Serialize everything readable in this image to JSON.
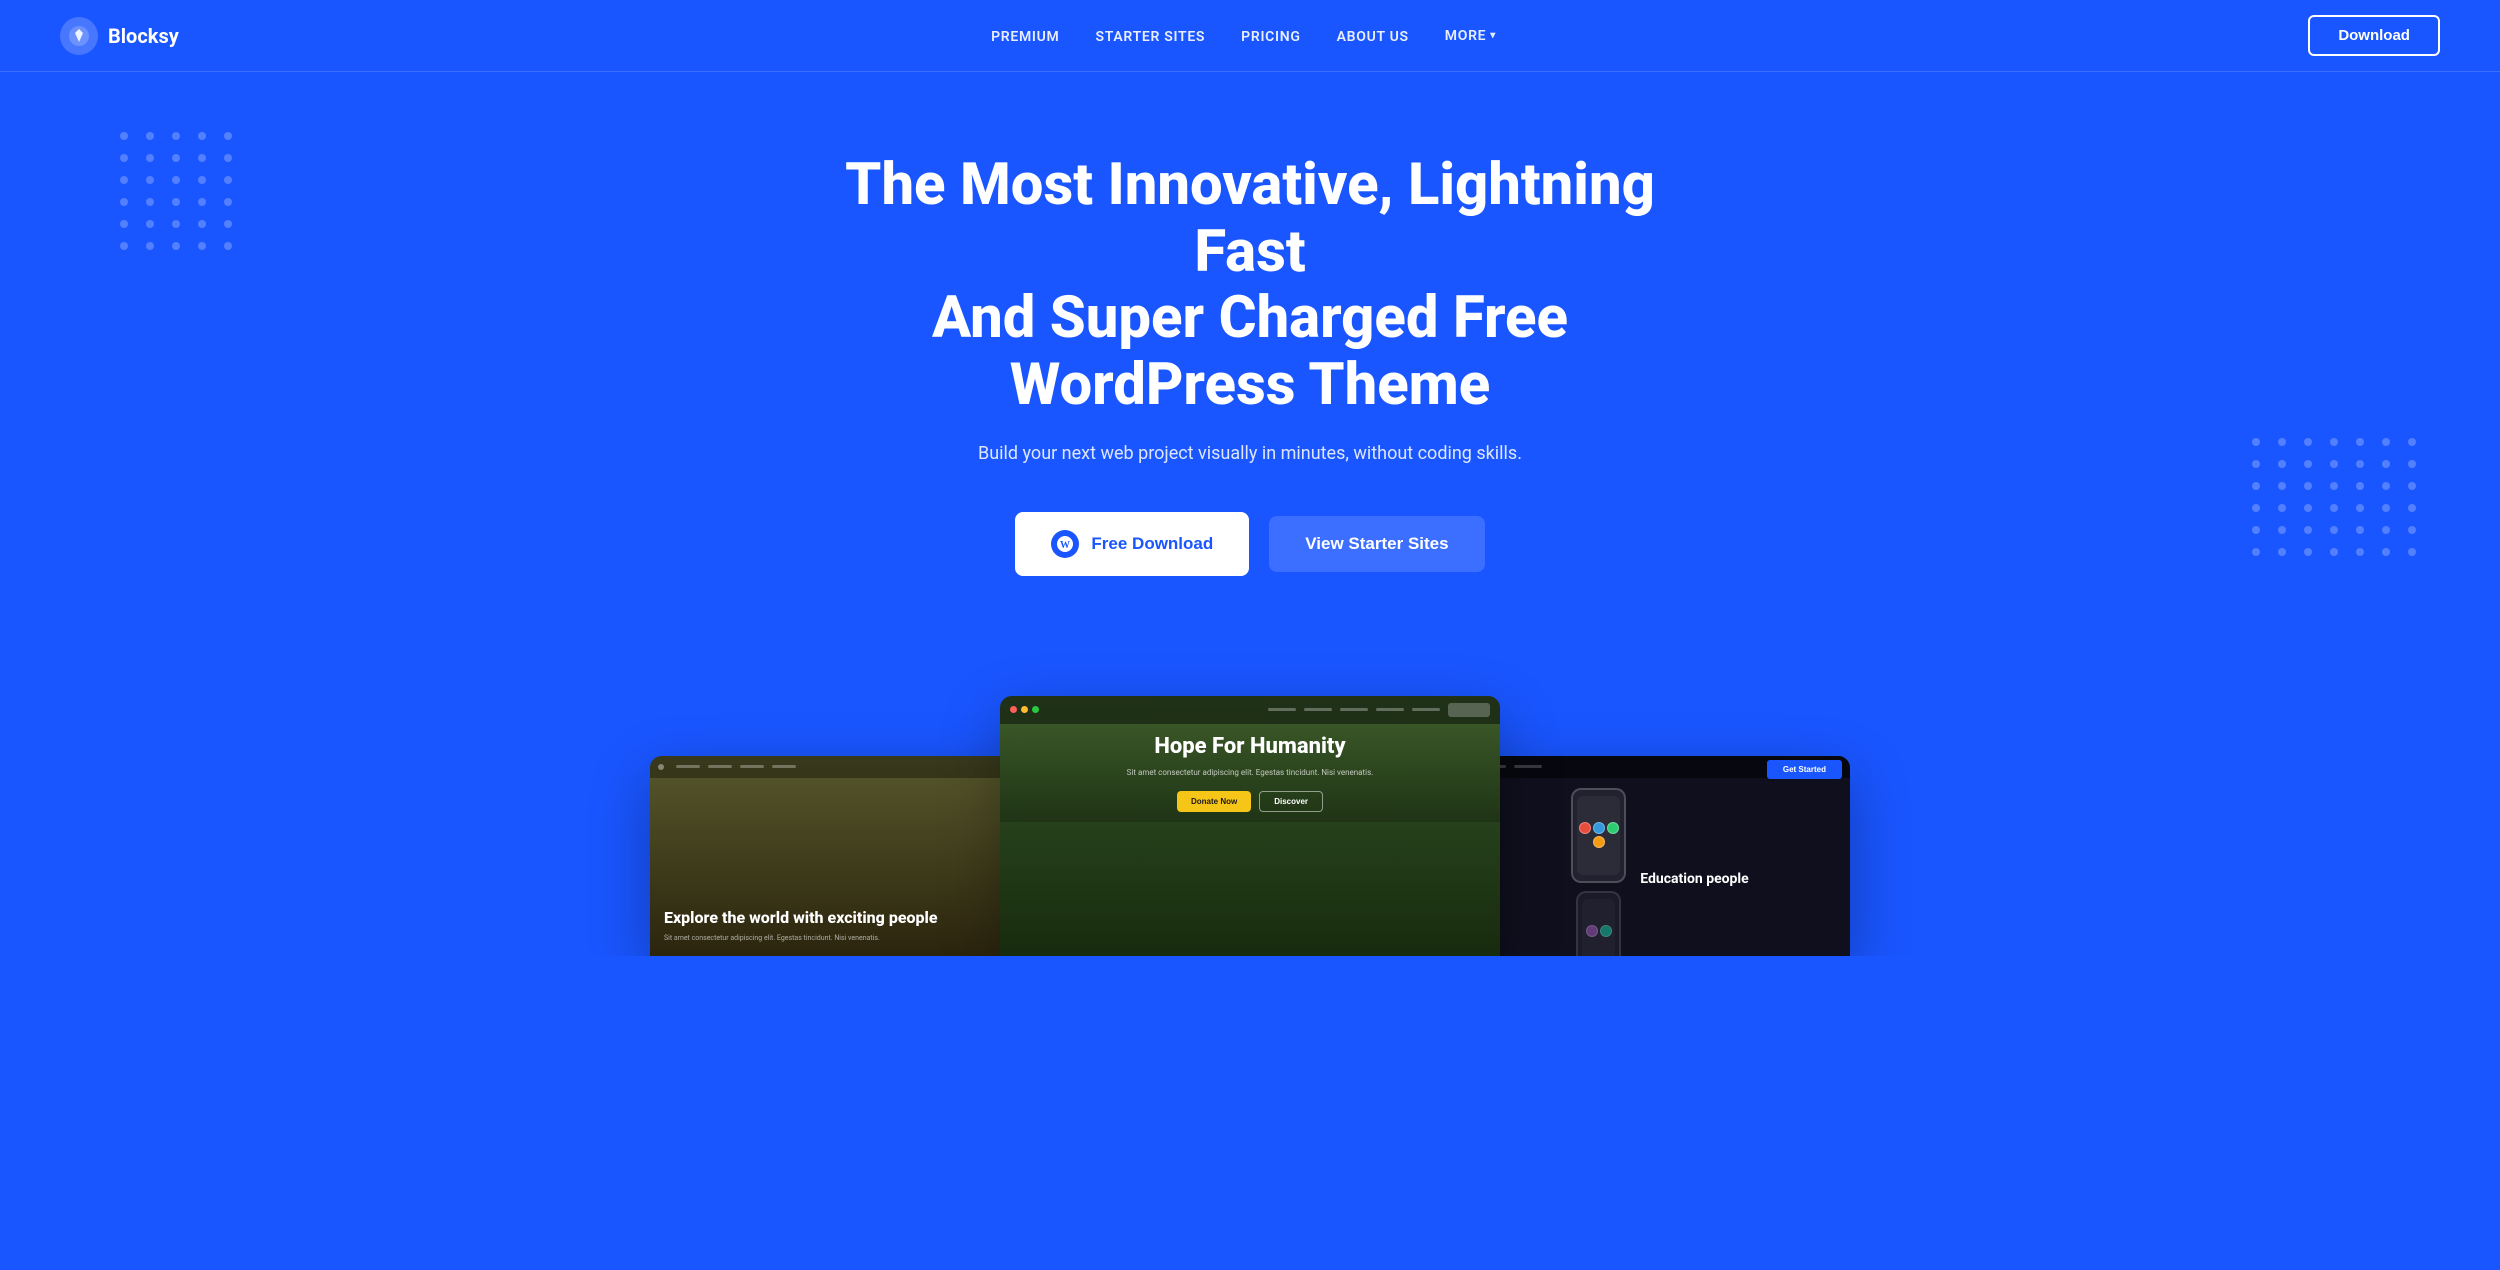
{
  "brand": {
    "logo_symbol": "⚡",
    "name": "Blocksy"
  },
  "nav": {
    "links": [
      {
        "id": "premium",
        "label": "PREMIUM"
      },
      {
        "id": "starter-sites",
        "label": "STARTER SITES"
      },
      {
        "id": "pricing",
        "label": "PRICING"
      },
      {
        "id": "about-us",
        "label": "ABOUT US"
      },
      {
        "id": "more",
        "label": "MORE"
      }
    ],
    "download_button": "Download"
  },
  "hero": {
    "title_line1": "The Most Innovative, Lightning Fast",
    "title_line2": "And Super Charged Free WordPress Theme",
    "subtitle": "Build your next web project visually in minutes, without coding skills.",
    "btn_free_download": "Free Download",
    "btn_starter_sites": "View Starter Sites",
    "wordpress_icon": "W"
  },
  "preview": {
    "cards": [
      {
        "id": "left",
        "title": "Explore the world with exciting people",
        "subtext": "Sit amet consectetur adipiscing elit. Egestas tincidunt. Nisi venenatis."
      },
      {
        "id": "main",
        "title": "Hope For Humanity",
        "subtext": "Sit amet consectetur adipiscing elit. Egestas tincidunt. Nisi venenatis.",
        "btn1": "Donate Now",
        "btn2": "Discover"
      },
      {
        "id": "right",
        "title": "Education people",
        "btn_label": "Get Started"
      }
    ]
  },
  "colors": {
    "primary": "#1a56ff",
    "nav_btn_border": "#ffffff",
    "hero_bg": "#1a56ff"
  }
}
